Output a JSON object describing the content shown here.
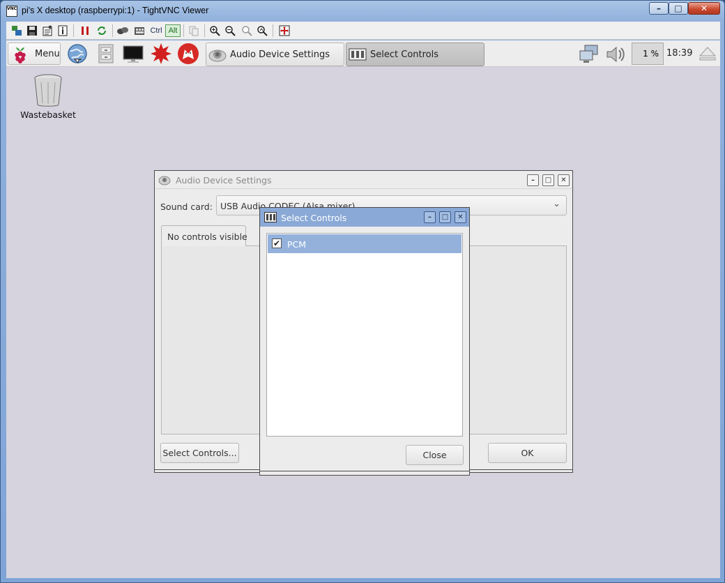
{
  "window": {
    "title": "pi's X desktop (raspberrypi:1) - TightVNC Viewer",
    "app_icon": "VNC",
    "controls": [
      "minimize-icon",
      "maximize-icon",
      "close-icon"
    ]
  },
  "vnc_toolbar": {
    "ctrl_label": "Ctrl",
    "alt_label": "Alt",
    "icons": [
      "new-connection-icon",
      "save-icon",
      "options-icon",
      "info-icon",
      "pause-icon",
      "refresh-icon",
      "send-ctrl-alt-del-icon",
      "send-keys-icon",
      "copy-icon",
      "zoom-in-icon",
      "zoom-out-icon",
      "zoom-100-icon",
      "zoom-auto-icon",
      "fullscreen-icon"
    ]
  },
  "panel": {
    "menu_label": "Menu",
    "tasks": [
      {
        "label": "Audio Device Settings",
        "active": false
      },
      {
        "label": "Select Controls",
        "active": true
      }
    ],
    "cpu_text": "1 %",
    "clock": "18:39"
  },
  "desktop": {
    "icons": [
      {
        "label": "Wastebasket"
      }
    ]
  },
  "audio_settings": {
    "title": "Audio Device Settings",
    "sound_card_label": "Sound card:",
    "sound_card_value": "USB Audio CODEC (Alsa mixer)",
    "tab_label": "No controls visible",
    "select_controls_button": "Select Controls...",
    "ok_button": "OK"
  },
  "select_controls": {
    "title": "Select Controls",
    "items": [
      {
        "label": "PCM",
        "checked": true
      }
    ],
    "close_button": "Close"
  },
  "colors": {
    "desktop_bg": "#d6d3df",
    "dialog_title_active": "#8aa9d6",
    "selection": "#94b1dc"
  }
}
